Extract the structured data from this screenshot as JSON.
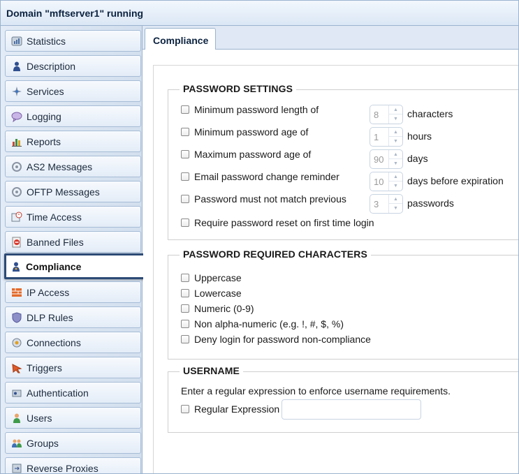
{
  "header": {
    "title": "Domain \"mftserver1\" running"
  },
  "sidebar": {
    "items": [
      {
        "label": "Statistics",
        "icon": "statistics-icon"
      },
      {
        "label": "Description",
        "icon": "person-icon"
      },
      {
        "label": "Services",
        "icon": "services-icon"
      },
      {
        "label": "Logging",
        "icon": "logging-icon"
      },
      {
        "label": "Reports",
        "icon": "reports-icon"
      },
      {
        "label": "AS2 Messages",
        "icon": "as2-icon"
      },
      {
        "label": "OFTP Messages",
        "icon": "oftp-icon"
      },
      {
        "label": "Time Access",
        "icon": "time-access-icon"
      },
      {
        "label": "Banned Files",
        "icon": "banned-files-icon"
      },
      {
        "label": "Compliance",
        "icon": "compliance-icon",
        "selected": true
      },
      {
        "label": "IP Access",
        "icon": "ip-access-icon"
      },
      {
        "label": "DLP Rules",
        "icon": "dlp-shield-icon"
      },
      {
        "label": "Connections",
        "icon": "connections-icon"
      },
      {
        "label": "Triggers",
        "icon": "triggers-icon"
      },
      {
        "label": "Authentication",
        "icon": "authentication-icon"
      },
      {
        "label": "Users",
        "icon": "user-icon"
      },
      {
        "label": "Groups",
        "icon": "groups-icon"
      },
      {
        "label": "Reverse Proxies",
        "icon": "reverse-proxies-icon"
      }
    ]
  },
  "tabs": [
    {
      "label": "Compliance",
      "active": true
    }
  ],
  "password_settings": {
    "legend": "PASSWORD SETTINGS",
    "rows": [
      {
        "label": "Minimum password length of",
        "checked": false,
        "value": "8",
        "unit": "characters"
      },
      {
        "label": "Minimum password age of",
        "checked": false,
        "value": "1",
        "unit": "hours"
      },
      {
        "label": "Maximum password age of",
        "checked": false,
        "value": "90",
        "unit": "days"
      },
      {
        "label": "Email password change reminder",
        "checked": false,
        "value": "10",
        "unit": "days before expiration"
      },
      {
        "label": "Password must not match previous",
        "checked": false,
        "value": "3",
        "unit": "passwords"
      }
    ],
    "reset_label": "Require password reset on first time login"
  },
  "required_characters": {
    "legend": "PASSWORD REQUIRED CHARACTERS",
    "items": [
      {
        "label": "Uppercase",
        "checked": false
      },
      {
        "label": "Lowercase",
        "checked": false
      },
      {
        "label": "Numeric (0-9)",
        "checked": false
      },
      {
        "label": "Non alpha-numeric (e.g. !, #, $, %)",
        "checked": false
      },
      {
        "label": "Deny login for password non-compliance",
        "checked": false
      }
    ]
  },
  "username": {
    "legend": "USERNAME",
    "description": "Enter a regular expression to enforce username requirements.",
    "regex_label": "Regular Expression",
    "regex_value": ""
  },
  "colors": {
    "selected_border": "#2c4a75",
    "header_text": "#0c2340",
    "sidebar_bg": "#d9e4f1"
  }
}
